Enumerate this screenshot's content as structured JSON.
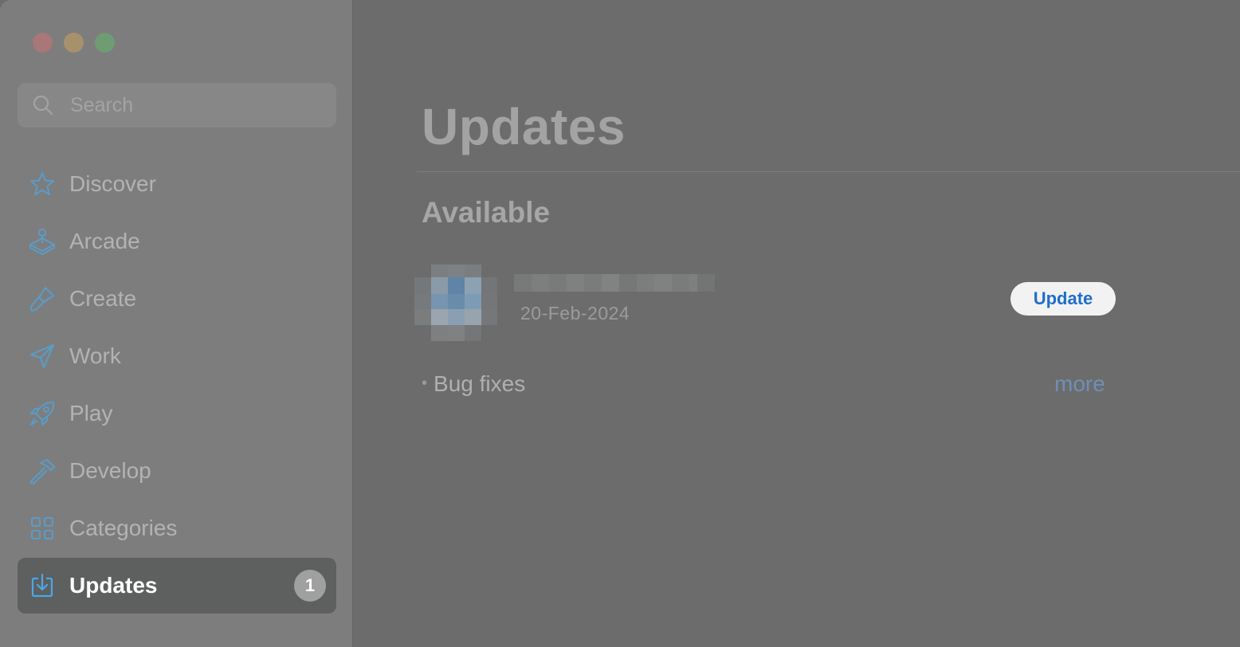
{
  "window": {
    "traffic_lights": [
      "close",
      "minimize",
      "zoom"
    ]
  },
  "sidebar": {
    "search": {
      "placeholder": "Search",
      "icon": "search-icon"
    },
    "items": [
      {
        "label": "Discover",
        "icon": "star-icon",
        "active": false
      },
      {
        "label": "Arcade",
        "icon": "joystick-icon",
        "active": false
      },
      {
        "label": "Create",
        "icon": "paintbrush-icon",
        "active": false
      },
      {
        "label": "Work",
        "icon": "paper-plane-icon",
        "active": false
      },
      {
        "label": "Play",
        "icon": "rocket-icon",
        "active": false
      },
      {
        "label": "Develop",
        "icon": "hammer-icon",
        "active": false
      },
      {
        "label": "Categories",
        "icon": "grid-icon",
        "active": false
      },
      {
        "label": "Updates",
        "icon": "download-icon",
        "active": true,
        "badge": "1"
      }
    ]
  },
  "main": {
    "title": "Updates",
    "section_title": "Available",
    "app": {
      "name_redacted": true,
      "date": "20-Feb-2024",
      "update_button": "Update",
      "notes": "Bug fixes",
      "more_link": "more"
    }
  },
  "colors": {
    "accent": "#1f6ecb",
    "icon_blue": "#5a9cc8",
    "sidebar_bg": "#7d7d7e",
    "main_bg": "#6b6c6b"
  }
}
